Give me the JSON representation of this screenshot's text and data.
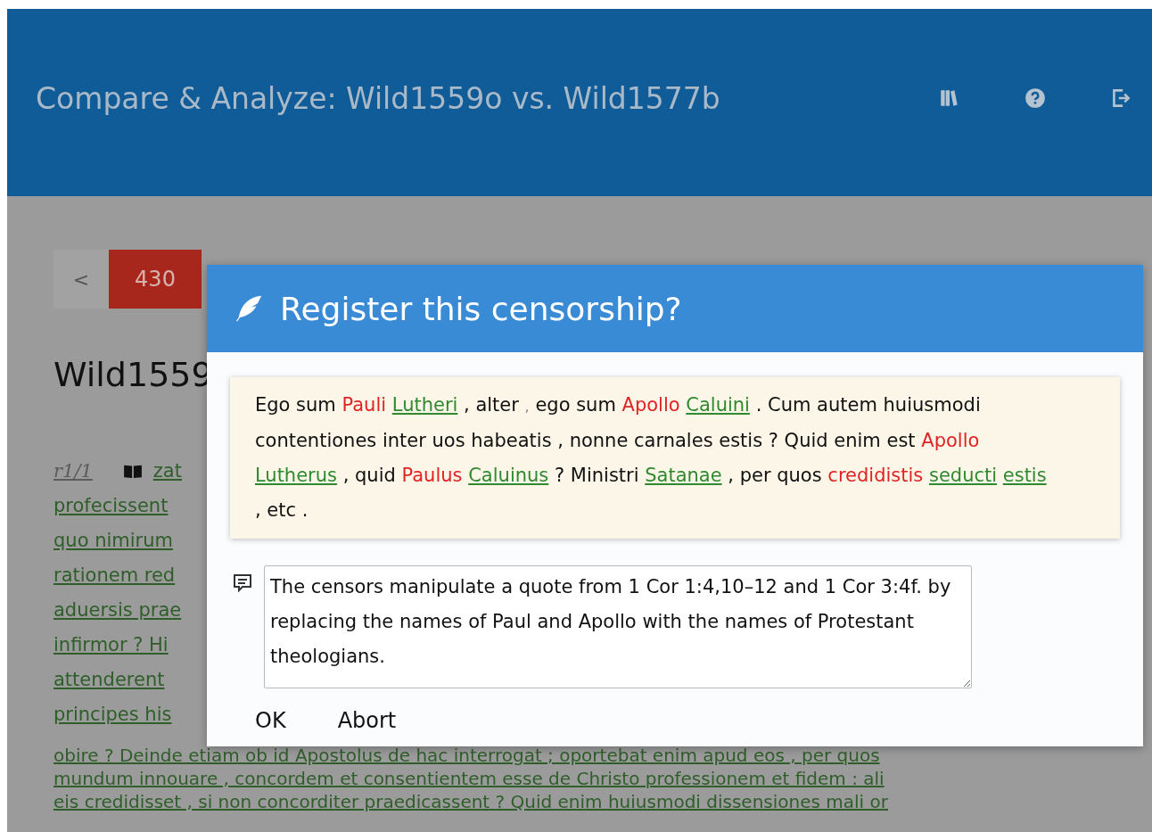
{
  "header": {
    "title": "Compare & Analyze: Wild1559o vs. Wild1577b"
  },
  "pager": {
    "prev": "<",
    "page": "430"
  },
  "document": {
    "heading": "Wild1559",
    "reference": "r1/1",
    "lines": [
      {
        "text": "zat",
        "kind": "fragment"
      },
      {
        "text": "profecissent",
        "kind": "fragment"
      },
      {
        "text": "quo nimirum",
        "kind": "fragment"
      },
      {
        "text": "rationem red",
        "kind": "fragment"
      },
      {
        "text": "aduersis prae",
        "kind": "fragment"
      },
      {
        "text": "infirmor ? Hi",
        "kind": "fragment"
      },
      {
        "text": "attenderent",
        "kind": "fragment"
      },
      {
        "text": "principes his",
        "kind": "fragment"
      },
      {
        "text": "obire ? Deinde etiam ob id Apostolus de hac interrogat ; oportebat enim apud eos , per quos",
        "kind": "full"
      },
      {
        "text": "mundum innouare , concordem et consentientem esse de Christo professionem et fidem : ali",
        "kind": "full"
      },
      {
        "text": "eis credidisset , si non concorditer praedicassent ? Quid enim huiusmodi dissensiones mali or",
        "kind": "full"
      }
    ]
  },
  "dialog": {
    "title": "Register this censorship?",
    "passage": [
      {
        "text": "Ego sum",
        "kind": "plain"
      },
      {
        "text": "Pauli",
        "kind": "removed"
      },
      {
        "text": "Lutheri",
        "kind": "added"
      },
      {
        "text": ", alter",
        "kind": "plain"
      },
      {
        "text": ",",
        "kind": "faint"
      },
      {
        "text": "ego sum",
        "kind": "plain"
      },
      {
        "text": "Apollo",
        "kind": "removed"
      },
      {
        "text": "Caluini",
        "kind": "added"
      },
      {
        "text": ". Cum autem huiusmodi contentiones inter uos habeatis , nonne carnales estis ? Quid enim est",
        "kind": "plain"
      },
      {
        "text": "Apollo",
        "kind": "removed"
      },
      {
        "text": "Lutherus",
        "kind": "added"
      },
      {
        "text": ", quid",
        "kind": "plain"
      },
      {
        "text": "Paulus",
        "kind": "removed"
      },
      {
        "text": "Caluinus",
        "kind": "added"
      },
      {
        "text": "? Ministri",
        "kind": "plain"
      },
      {
        "text": "Satanae",
        "kind": "added"
      },
      {
        "text": ", per quos",
        "kind": "plain"
      },
      {
        "text": "credidistis",
        "kind": "removed"
      },
      {
        "text": "seducti",
        "kind": "added"
      },
      {
        "text": "estis",
        "kind": "added"
      },
      {
        "text": ", etc .",
        "kind": "plain"
      }
    ],
    "comment": "The censors manipulate a quote from 1 Cor 1:4,10–12 and 1 Cor 3:4f. by replacing the names of Paul and Apollo with the names of Protestant theologians.",
    "buttons": [
      "OK",
      "Abort"
    ]
  }
}
